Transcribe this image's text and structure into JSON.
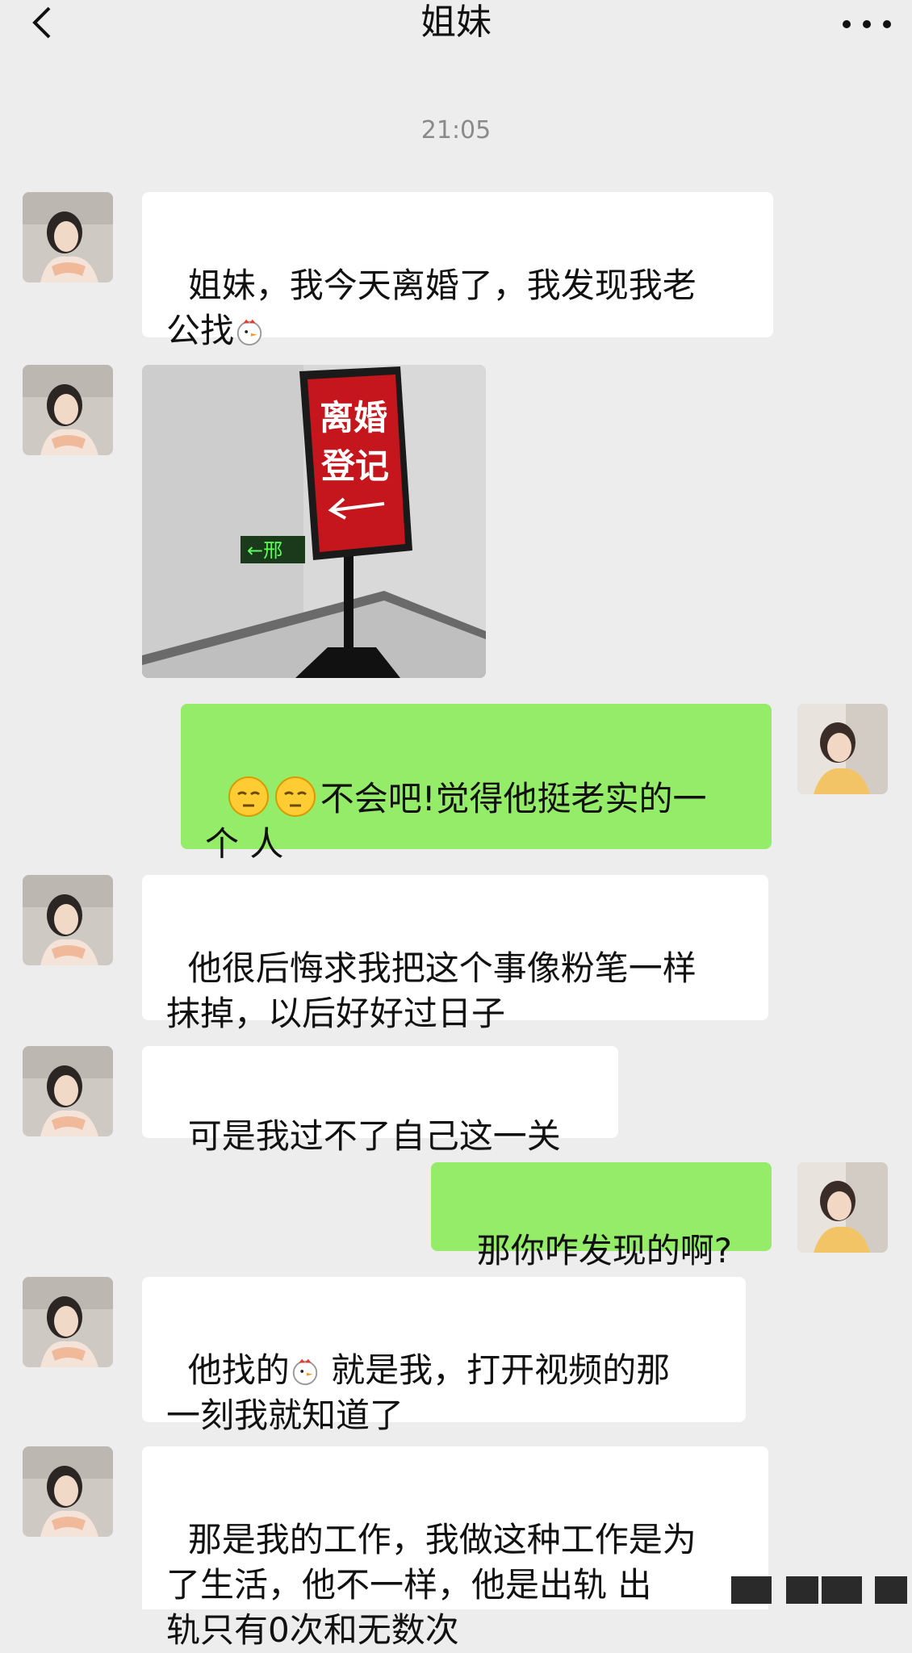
{
  "header": {
    "title": "姐妹",
    "back_icon": "chevron-left-icon",
    "more_icon": "more-dots-icon"
  },
  "timestamp": "21:05",
  "messages": [
    {
      "side": "left",
      "type": "text",
      "text_before": "姐妹，我今天离婚了，我发现我老\n公找",
      "emoji": "chick-icon"
    },
    {
      "side": "left",
      "type": "image",
      "image": {
        "sign_line1": "离婚",
        "sign_line2": "登记",
        "exit_sign": "←邢"
      }
    },
    {
      "side": "right",
      "type": "text",
      "emoji": "sleepy-face-icon",
      "text": "不会吧!觉得他挺老实的一\n个 人"
    },
    {
      "side": "left",
      "type": "text",
      "text": "他很后悔求我把这个事像粉笔一样\n抹掉，以后好好过日子"
    },
    {
      "side": "left",
      "type": "text",
      "text": "可是我过不了自己这一关"
    },
    {
      "side": "right",
      "type": "text",
      "text": "那你咋发现的啊?"
    },
    {
      "side": "left",
      "type": "text",
      "text_before": "他找的",
      "emoji": "chick-icon",
      "text_after": " 就是我，打开视频的那\n一刻我就知道了"
    },
    {
      "side": "left",
      "type": "text",
      "text": "那是我的工作，我做这种工作是为\n了生活，他不一样，他是出轨 出\n轨只有0次和无数次"
    }
  ],
  "colors": {
    "background": "#ededed",
    "bubble_left": "#ffffff",
    "bubble_right": "#95ec69",
    "sign_red": "#c4161c"
  }
}
